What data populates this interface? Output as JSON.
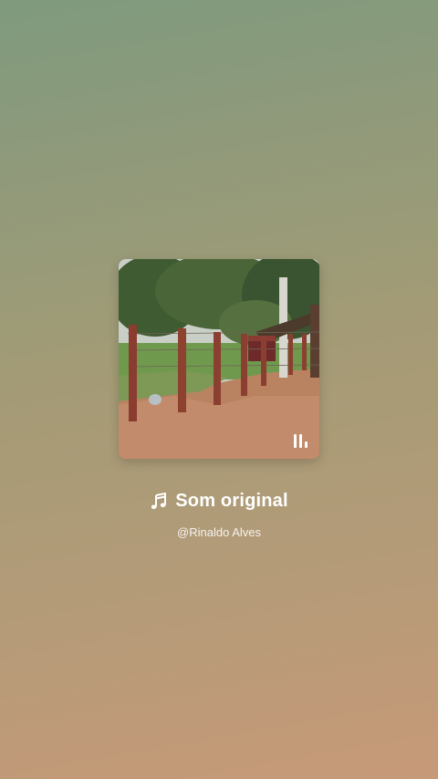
{
  "sound": {
    "title": "Som original",
    "author": "@Rinaldo Alves",
    "note_icon": "music-note-icon",
    "playing_icon": "equalizer-bars-icon",
    "cover_description_icon": "album-cover-image"
  },
  "colors": {
    "background_top": "#7f9a7e",
    "background_bottom": "#c79a78",
    "text": "#ffffff"
  }
}
